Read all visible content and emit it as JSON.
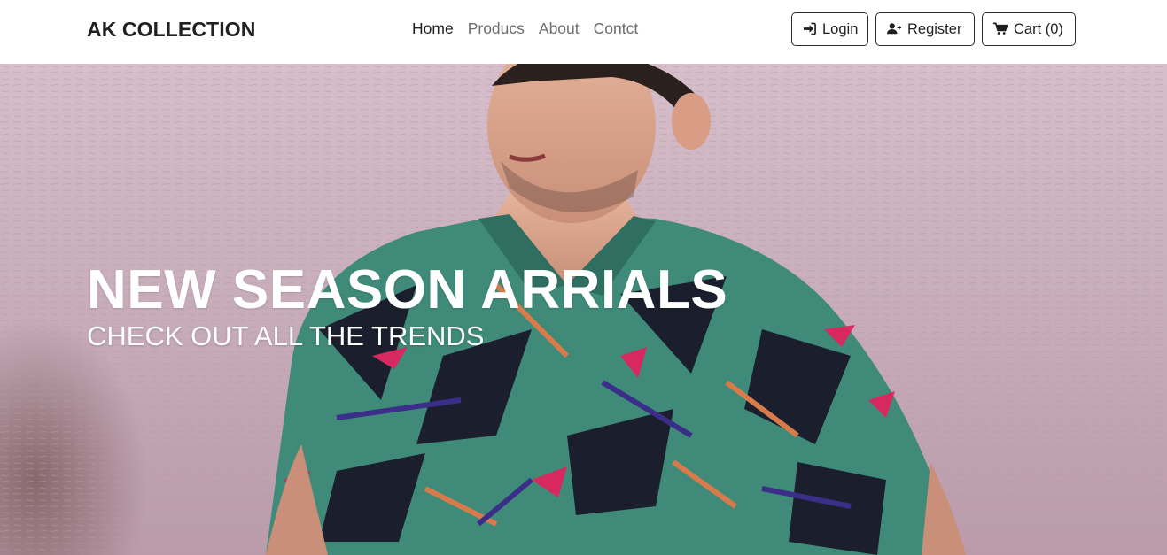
{
  "navbar": {
    "brand": "AK COLLECTION",
    "links": [
      {
        "label": "Home",
        "active": true
      },
      {
        "label": "Producs",
        "active": false
      },
      {
        "label": "About",
        "active": false
      },
      {
        "label": "Contct",
        "active": false
      }
    ],
    "buttons": {
      "login": {
        "label": "Login",
        "icon": "sign-in-icon"
      },
      "register": {
        "label": "Register",
        "icon": "user-plus-icon"
      },
      "cart": {
        "label": "Cart (0)",
        "icon": "shopping-cart-icon"
      }
    }
  },
  "hero": {
    "title": "NEW SEASON ARRIALS",
    "subtitle": "CHECK OUT ALL THE TRENDS"
  },
  "colors": {
    "text_dark": "#1f1f1f",
    "nav_muted": "#6c6c6c",
    "hero_wall": "#d6bfca",
    "shirt_teal": "#3f8a78",
    "shirt_pink": "#e0245e",
    "shirt_purple": "#3b2a8a",
    "shirt_orange": "#e07a4a"
  }
}
